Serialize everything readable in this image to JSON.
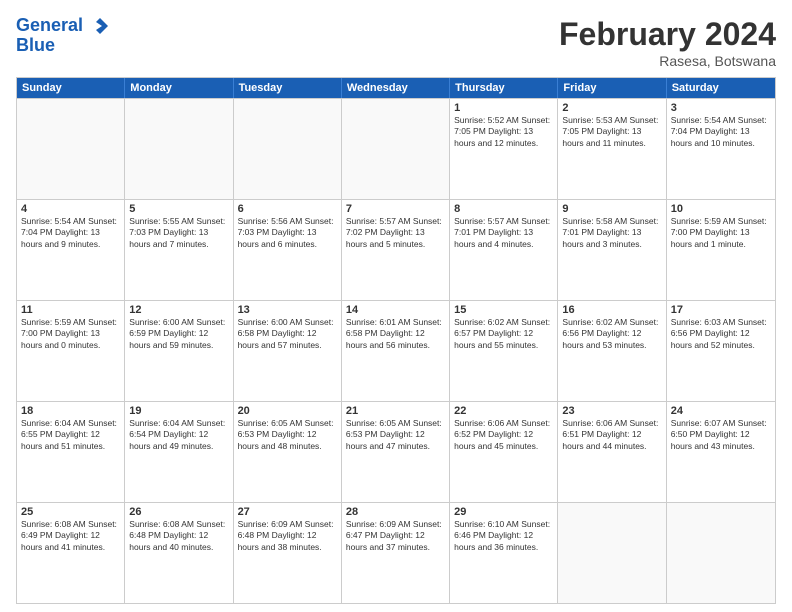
{
  "logo": {
    "line1": "General",
    "line2": "Blue"
  },
  "title": "February 2024",
  "location": "Rasesa, Botswana",
  "days_of_week": [
    "Sunday",
    "Monday",
    "Tuesday",
    "Wednesday",
    "Thursday",
    "Friday",
    "Saturday"
  ],
  "weeks": [
    [
      {
        "day": "",
        "info": ""
      },
      {
        "day": "",
        "info": ""
      },
      {
        "day": "",
        "info": ""
      },
      {
        "day": "",
        "info": ""
      },
      {
        "day": "1",
        "info": "Sunrise: 5:52 AM\nSunset: 7:05 PM\nDaylight: 13 hours and 12 minutes."
      },
      {
        "day": "2",
        "info": "Sunrise: 5:53 AM\nSunset: 7:05 PM\nDaylight: 13 hours and 11 minutes."
      },
      {
        "day": "3",
        "info": "Sunrise: 5:54 AM\nSunset: 7:04 PM\nDaylight: 13 hours and 10 minutes."
      }
    ],
    [
      {
        "day": "4",
        "info": "Sunrise: 5:54 AM\nSunset: 7:04 PM\nDaylight: 13 hours and 9 minutes."
      },
      {
        "day": "5",
        "info": "Sunrise: 5:55 AM\nSunset: 7:03 PM\nDaylight: 13 hours and 7 minutes."
      },
      {
        "day": "6",
        "info": "Sunrise: 5:56 AM\nSunset: 7:03 PM\nDaylight: 13 hours and 6 minutes."
      },
      {
        "day": "7",
        "info": "Sunrise: 5:57 AM\nSunset: 7:02 PM\nDaylight: 13 hours and 5 minutes."
      },
      {
        "day": "8",
        "info": "Sunrise: 5:57 AM\nSunset: 7:01 PM\nDaylight: 13 hours and 4 minutes."
      },
      {
        "day": "9",
        "info": "Sunrise: 5:58 AM\nSunset: 7:01 PM\nDaylight: 13 hours and 3 minutes."
      },
      {
        "day": "10",
        "info": "Sunrise: 5:59 AM\nSunset: 7:00 PM\nDaylight: 13 hours and 1 minute."
      }
    ],
    [
      {
        "day": "11",
        "info": "Sunrise: 5:59 AM\nSunset: 7:00 PM\nDaylight: 13 hours and 0 minutes."
      },
      {
        "day": "12",
        "info": "Sunrise: 6:00 AM\nSunset: 6:59 PM\nDaylight: 12 hours and 59 minutes."
      },
      {
        "day": "13",
        "info": "Sunrise: 6:00 AM\nSunset: 6:58 PM\nDaylight: 12 hours and 57 minutes."
      },
      {
        "day": "14",
        "info": "Sunrise: 6:01 AM\nSunset: 6:58 PM\nDaylight: 12 hours and 56 minutes."
      },
      {
        "day": "15",
        "info": "Sunrise: 6:02 AM\nSunset: 6:57 PM\nDaylight: 12 hours and 55 minutes."
      },
      {
        "day": "16",
        "info": "Sunrise: 6:02 AM\nSunset: 6:56 PM\nDaylight: 12 hours and 53 minutes."
      },
      {
        "day": "17",
        "info": "Sunrise: 6:03 AM\nSunset: 6:56 PM\nDaylight: 12 hours and 52 minutes."
      }
    ],
    [
      {
        "day": "18",
        "info": "Sunrise: 6:04 AM\nSunset: 6:55 PM\nDaylight: 12 hours and 51 minutes."
      },
      {
        "day": "19",
        "info": "Sunrise: 6:04 AM\nSunset: 6:54 PM\nDaylight: 12 hours and 49 minutes."
      },
      {
        "day": "20",
        "info": "Sunrise: 6:05 AM\nSunset: 6:53 PM\nDaylight: 12 hours and 48 minutes."
      },
      {
        "day": "21",
        "info": "Sunrise: 6:05 AM\nSunset: 6:53 PM\nDaylight: 12 hours and 47 minutes."
      },
      {
        "day": "22",
        "info": "Sunrise: 6:06 AM\nSunset: 6:52 PM\nDaylight: 12 hours and 45 minutes."
      },
      {
        "day": "23",
        "info": "Sunrise: 6:06 AM\nSunset: 6:51 PM\nDaylight: 12 hours and 44 minutes."
      },
      {
        "day": "24",
        "info": "Sunrise: 6:07 AM\nSunset: 6:50 PM\nDaylight: 12 hours and 43 minutes."
      }
    ],
    [
      {
        "day": "25",
        "info": "Sunrise: 6:08 AM\nSunset: 6:49 PM\nDaylight: 12 hours and 41 minutes."
      },
      {
        "day": "26",
        "info": "Sunrise: 6:08 AM\nSunset: 6:48 PM\nDaylight: 12 hours and 40 minutes."
      },
      {
        "day": "27",
        "info": "Sunrise: 6:09 AM\nSunset: 6:48 PM\nDaylight: 12 hours and 38 minutes."
      },
      {
        "day": "28",
        "info": "Sunrise: 6:09 AM\nSunset: 6:47 PM\nDaylight: 12 hours and 37 minutes."
      },
      {
        "day": "29",
        "info": "Sunrise: 6:10 AM\nSunset: 6:46 PM\nDaylight: 12 hours and 36 minutes."
      },
      {
        "day": "",
        "info": ""
      },
      {
        "day": "",
        "info": ""
      }
    ]
  ]
}
